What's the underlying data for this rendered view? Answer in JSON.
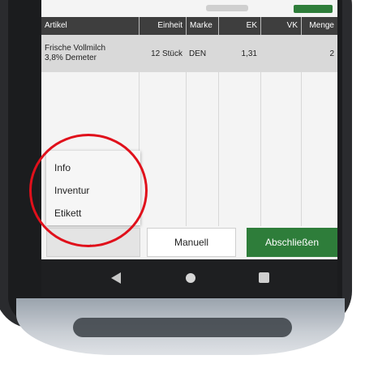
{
  "table": {
    "headers": {
      "artikel": "Artikel",
      "einheit": "Einheit",
      "marke": "Marke",
      "ek": "EK",
      "vk": "VK",
      "menge": "Menge"
    },
    "rows": [
      {
        "artikel_line1": "Frische Vollmilch",
        "artikel_line2": "3,8% Demeter",
        "einheit": "12 Stück",
        "marke": "DEN",
        "ek": "1,31",
        "vk": "",
        "menge": "2"
      }
    ]
  },
  "context_menu": {
    "items": [
      "Info",
      "Inventur",
      "Etikett"
    ]
  },
  "buttons": {
    "more_label": "...",
    "manuell_label": "Manuell",
    "abschliessen_label": "Abschließen"
  },
  "icons": {
    "back": "back-triangle-icon",
    "home": "home-circle-icon",
    "recent": "recent-apps-square-icon"
  },
  "colors": {
    "header_bg": "#3e3e3e",
    "primary_green": "#2e7d3a",
    "annotation_red": "#e0101b"
  }
}
